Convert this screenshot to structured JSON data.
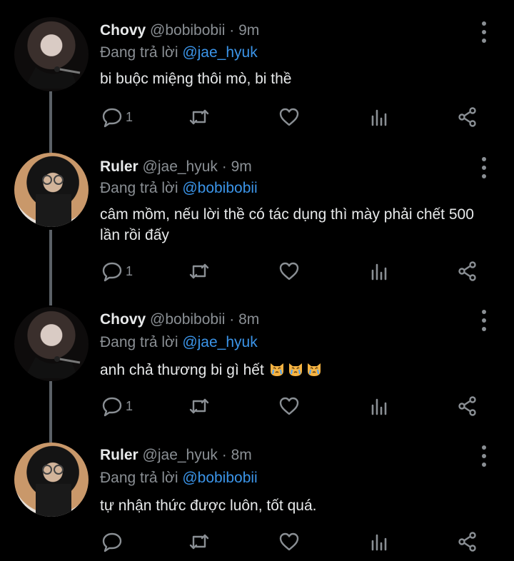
{
  "tweets": [
    {
      "name": "Chovy",
      "handle": "@bobibobii",
      "sep": "·",
      "time": "9m",
      "reply_prefix": "Đang trả lời",
      "reply_to": "@jae_hyuk",
      "text": "bi buộc miệng thôi mò, bi thề",
      "reply_count": "1",
      "avatar": "chovy-avatar"
    },
    {
      "name": "Ruler",
      "handle": "@jae_hyuk",
      "sep": "·",
      "time": "9m",
      "reply_prefix": "Đang trả lời",
      "reply_to": "@bobibobii",
      "text": "câm mồm, nếu lời thề có tác dụng thì mày phải chết 500 lần rồi đấy",
      "reply_count": "1",
      "avatar": "ruler-avatar"
    },
    {
      "name": "Chovy",
      "handle": "@bobibobii",
      "sep": "·",
      "time": "8m",
      "reply_prefix": "Đang trả lời",
      "reply_to": "@jae_hyuk",
      "text": "anh chả thương bi gì hết",
      "emoji": "crying-cat-face",
      "emoji_count": 3,
      "reply_count": "1",
      "avatar": "chovy-avatar"
    },
    {
      "name": "Ruler",
      "handle": "@jae_hyuk",
      "sep": "·",
      "time": "8m",
      "reply_prefix": "Đang trả lời",
      "reply_to": "@bobibobii",
      "text": "tự nhận thức được luôn, tốt quá.",
      "reply_count": "",
      "avatar": "ruler-avatar"
    }
  ],
  "colors": {
    "background": "#000000",
    "text": "#e7e9ea",
    "muted": "#8a8f94",
    "mention": "#3b94e8",
    "thread_line": "#5b6167"
  },
  "icons": [
    "reply-icon",
    "retweet-icon",
    "like-icon",
    "stats-icon",
    "share-icon",
    "more-icon"
  ]
}
